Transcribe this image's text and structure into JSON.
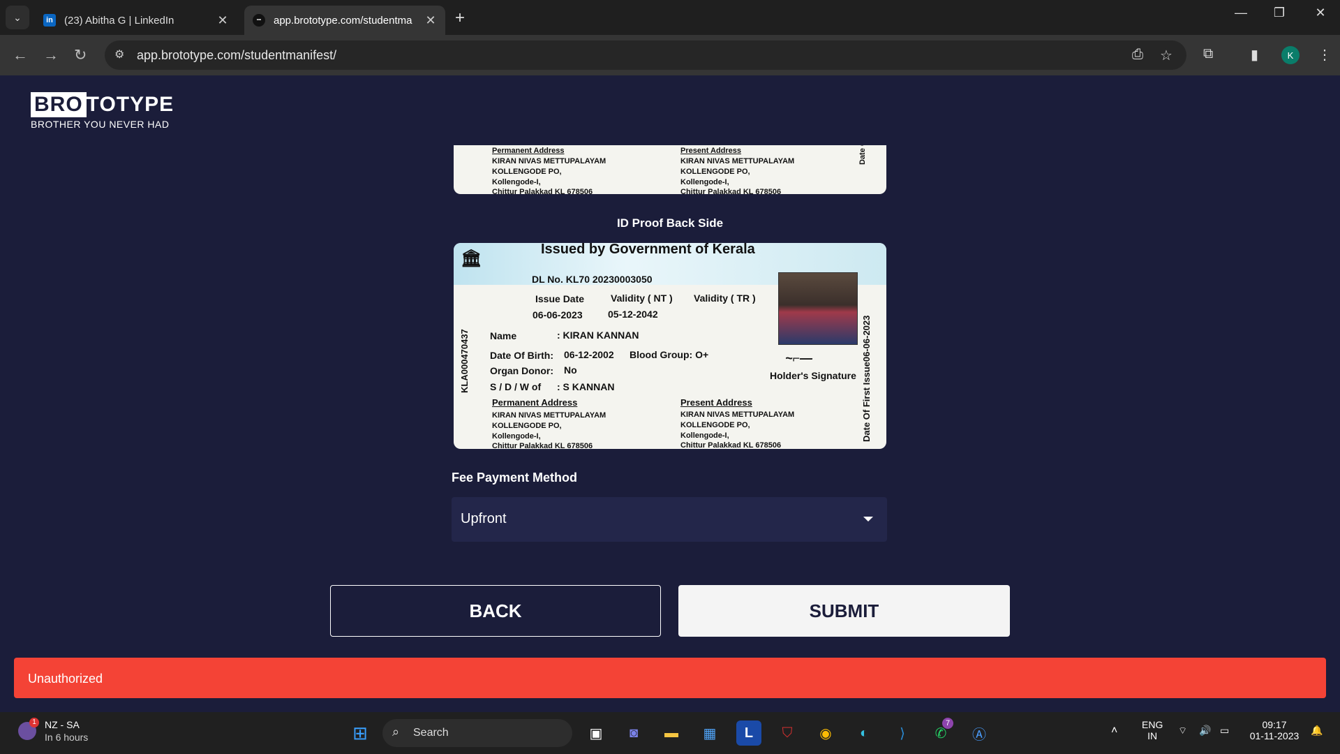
{
  "browser": {
    "tabs": [
      {
        "title": "(23) Abitha G | LinkedIn",
        "favicon": "linkedin-icon"
      },
      {
        "title": "app.brototype.com/studentma",
        "favicon": "brototype-icon"
      }
    ],
    "url": "app.brototype.com/studentmanifest/",
    "profile_initial": "K"
  },
  "logo": {
    "bro": "BRO",
    "totype": "TOTYPE",
    "tagline": "BROTHER YOU NEVER HAD"
  },
  "id_front_partial": {
    "permanent_address_label": "Permanent Address",
    "present_address_label": "Present Address",
    "address_line1": "KIRAN NIVAS METTUPALAYAM",
    "address_line2": "KOLLENGODE PO,",
    "address_line3": "Kollengode-I,",
    "address_line4": "Chittur Palakkad KL 678506",
    "side_text": "Date Of"
  },
  "id_back": {
    "section_label": "ID Proof Back Side",
    "issued_by": "Issued by Government of Kerala",
    "dl_no": "DL No. KL70 20230003050",
    "issue_date_label": "Issue Date",
    "validity_nt_label": "Validity ( NT )",
    "validity_tr_label": "Validity  ( TR )",
    "issue_date": "06-06-2023",
    "validity_nt": "05-12-2042",
    "name_label": "Name",
    "name": ": KIRAN KANNAN",
    "dob_label": "Date Of Birth:",
    "dob": "06-12-2002",
    "blood_group": "Blood Group: O+",
    "organ_donor_label": "Organ Donor:",
    "organ_donor": "No",
    "relation_label": "S / D / W of",
    "relation": ": S KANNAN",
    "holder_signature": "Holder's Signature",
    "permanent_address_label": "Permanent Address",
    "present_address_label": "Present Address",
    "address_line1": "KIRAN NIVAS METTUPALAYAM",
    "address_line2": "KOLLENGODE PO,",
    "address_line3": "Kollengode-I,",
    "address_line4": "Chittur Palakkad KL 678506",
    "left_vertical": "KLA000470437",
    "right_vertical": "Date Of First Issue06-06-2023"
  },
  "form": {
    "fee_label": "Fee Payment Method",
    "fee_value": "Upfront",
    "back_label": "BACK",
    "submit_label": "SUBMIT"
  },
  "toast": {
    "message": "Unauthorized",
    "color": "#f44336"
  },
  "taskbar": {
    "weather_location": "NZ - SA",
    "weather_sub": "In 6 hours",
    "search_label": "Search",
    "lang_line1": "ENG",
    "lang_line2": "IN",
    "time": "09:17",
    "date": "01-11-2023",
    "whatsapp_badge": "7",
    "weather_badge": "1"
  }
}
